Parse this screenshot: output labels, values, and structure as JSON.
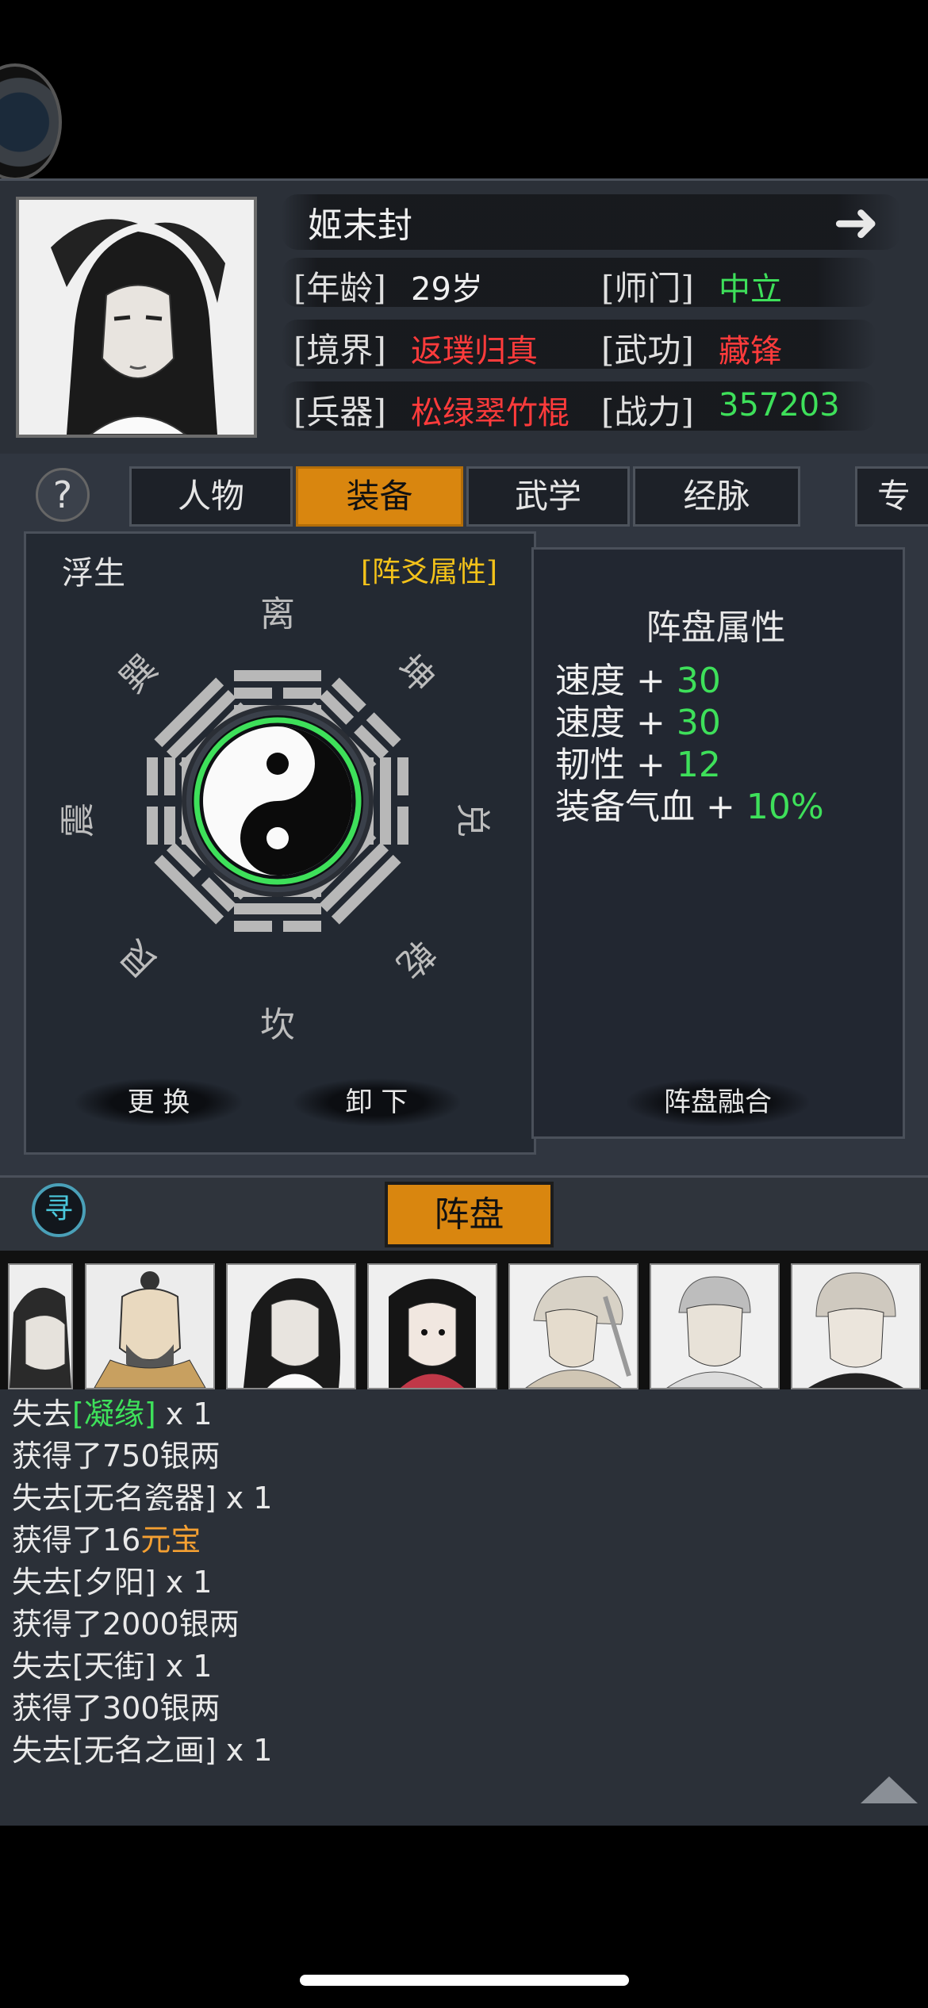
{
  "character": {
    "name": "姬末封",
    "age_label": "[年龄]",
    "age": "29岁",
    "sect_label": "[师门]",
    "sect": "中立",
    "realm_label": "[境界]",
    "realm": "返璞归真",
    "martial_label": "[武功]",
    "martial": "藏锋",
    "weapon_label": "[兵器]",
    "weapon": "松绿翠竹棍",
    "power_label": "[战力]",
    "power": "357203"
  },
  "tabs": [
    {
      "label": "人物",
      "active": false
    },
    {
      "label": "装备",
      "active": true
    },
    {
      "label": "武学",
      "active": false
    },
    {
      "label": "经脉",
      "active": false
    },
    {
      "label": "专",
      "active": false
    }
  ],
  "help_label": "?",
  "equipment": {
    "set_name": "浮生",
    "set_attr_link": "[阵爻属性]",
    "trigrams": {
      "top": "离",
      "top_right": "坤",
      "right": "兑",
      "bottom_right": "乾",
      "bottom": "坎",
      "bottom_left": "艮",
      "left": "震",
      "top_left": "巽"
    },
    "replace_label": "更 换",
    "unequip_label": "卸 下"
  },
  "attributes": {
    "title": "阵盘属性",
    "rows": [
      {
        "name": "速度",
        "sign": "+",
        "value": "30"
      },
      {
        "name": "速度",
        "sign": "+",
        "value": "30"
      },
      {
        "name": "韧性",
        "sign": "+",
        "value": "12"
      },
      {
        "name": "装备气血",
        "sign": "+",
        "value": "10%"
      }
    ],
    "fuse_label": "阵盘融合"
  },
  "bottom_tab": "阵盘",
  "seek_label": "寻",
  "log": [
    {
      "pre": "失去",
      "item": "[凝缘]",
      "post": " x 1",
      "item_color": "green"
    },
    {
      "pre": "获得了750银两",
      "item": "",
      "post": "",
      "item_color": ""
    },
    {
      "pre": "失去[无名瓷器] x 1",
      "item": "",
      "post": "",
      "item_color": ""
    },
    {
      "pre": "获得了16",
      "item": "元宝",
      "post": "",
      "item_color": "orange"
    },
    {
      "pre": "失去[夕阳] x 1",
      "item": "",
      "post": "",
      "item_color": ""
    },
    {
      "pre": "获得了2000银两",
      "item": "",
      "post": "",
      "item_color": ""
    },
    {
      "pre": "失去[天街] x 1",
      "item": "",
      "post": "",
      "item_color": ""
    },
    {
      "pre": "获得了300银两",
      "item": "",
      "post": "",
      "item_color": ""
    },
    {
      "pre": "失去[无名之画] x 1",
      "item": "",
      "post": "",
      "item_color": ""
    }
  ],
  "colors": {
    "accent": "#d9860f",
    "green": "#3ee05a",
    "red": "#ff3b3b",
    "gold": "#f3c21a",
    "orange": "#f5a032"
  }
}
